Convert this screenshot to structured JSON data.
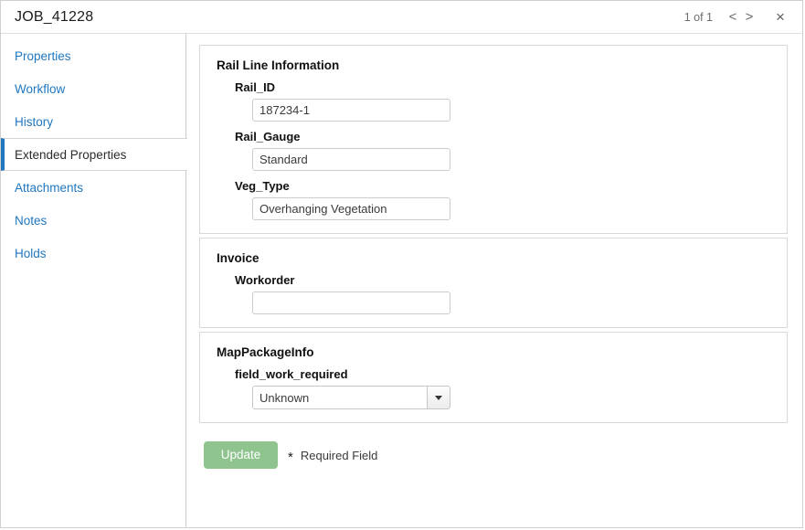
{
  "header": {
    "job_title": "JOB_41228",
    "page_counter": "1 of 1",
    "prev_label": "<",
    "next_label": ">",
    "close_label": "×"
  },
  "sidebar": {
    "items": [
      {
        "label": "Properties",
        "active": false
      },
      {
        "label": "Workflow",
        "active": false
      },
      {
        "label": "History",
        "active": false
      },
      {
        "label": "Extended Properties",
        "active": true
      },
      {
        "label": "Attachments",
        "active": false
      },
      {
        "label": "Notes",
        "active": false
      },
      {
        "label": "Holds",
        "active": false
      }
    ]
  },
  "content": {
    "groups": [
      {
        "title": "Rail Line Information",
        "fields": [
          {
            "label": "Rail_ID",
            "value": "187234-1",
            "placeholder": "",
            "type": "text"
          },
          {
            "label": "Rail_Gauge",
            "value": "Standard",
            "placeholder": "",
            "type": "text"
          },
          {
            "label": "Veg_Type",
            "value": "Overhanging Vegetation",
            "placeholder": "",
            "type": "text"
          }
        ]
      },
      {
        "title": "Invoice",
        "fields": [
          {
            "label": "Workorder",
            "value": "",
            "placeholder": "",
            "type": "text"
          }
        ]
      },
      {
        "title": "MapPackageInfo",
        "fields": [
          {
            "label": "field_work_required",
            "value": "Unknown",
            "placeholder": "",
            "type": "select"
          }
        ]
      }
    ]
  },
  "footer": {
    "update_label": "Update",
    "required_star": "*",
    "required_text": "Required Field"
  },
  "colors": {
    "link_blue": "#1f77c0",
    "active_accent": "#1f77c0",
    "update_green": "#8fc48f",
    "border_gray": "#d8d8d8"
  }
}
